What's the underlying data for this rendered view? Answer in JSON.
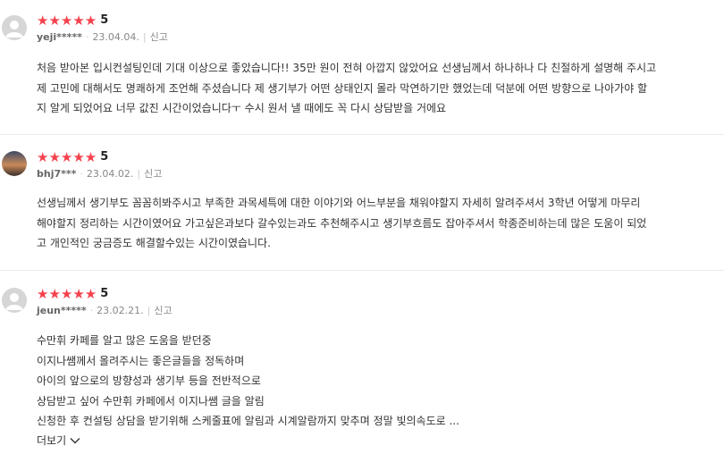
{
  "reviews": [
    {
      "stars": "★★★★★",
      "score": "5",
      "user": "yeji*****",
      "date": "23.04.04.",
      "report": "신고",
      "lines": [
        "처음 받아본 입시컨설팅인데 기대 이상으로 좋았습니다!! 35만 원이 전혀 아깝지 않았어요 선생님께서 하나하나 다 친절하게 설명해 주시고",
        "제 고민에 대해서도 명쾌하게 조언해 주셨습니다 제 생기부가 어떤 상태인지 몰라 막연하기만 했었는데 덕분에 어떤 방향으로 나아가야 할",
        "지 알게 되었어요 너무 값진 시간이었습니다ㅜ 수시 원서 낼 때에도 꼭 다시 상담받을 거에요"
      ]
    },
    {
      "stars": "★★★★★",
      "score": "5",
      "user": "bhj7***",
      "date": "23.04.02.",
      "report": "신고",
      "lines": [
        "선생님께서 생기부도 꼼꼼히봐주시고 부족한 과목세특에 대한 이야기와 어느부분을 채워야할지 자세히 알려주셔서 3학년 어떻게 마무리",
        "해야할지 정리하는 시간이였어요 가고싶은과보다 갈수있는과도 추천해주시고 생기부흐름도 잡아주셔서 학종준비하는데 많은 도움이 되었",
        "고 개인적인 궁금증도 해결할수있는 시간이였습니다."
      ]
    },
    {
      "stars": "★★★★★",
      "score": "5",
      "user": "jeun*****",
      "date": "23.02.21.",
      "report": "신고",
      "lines": [
        "수만휘 카페를 알고 많은 도움을 받던중",
        "이지나쌤께서  올려주시는 좋은글들을 정독하며",
        "아이의 앞으로의 방향성과 생기부 등을 전반적으로",
        "상담받고 싶어 수만휘 카페에서 이지나쌤 글을 알림",
        "신청한 후 컨설팅 상담을 받기위해 스케줄표에 알림과 시계알람까지 맞추며 정말 빛의속도로 ..."
      ],
      "more_label": "더보기"
    }
  ],
  "colors": {
    "star": "#f5424d"
  }
}
